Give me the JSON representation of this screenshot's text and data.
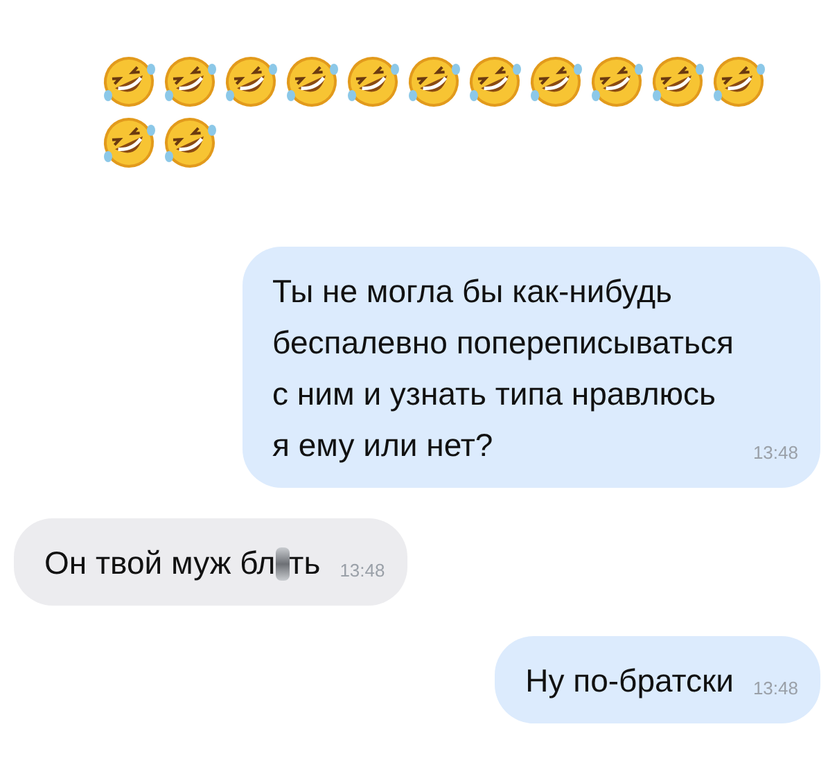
{
  "emojis": [
    {
      "kind": "rofl"
    },
    {
      "kind": "rofl"
    },
    {
      "kind": "rofl"
    },
    {
      "kind": "rofl"
    },
    {
      "kind": "rofl"
    },
    {
      "kind": "rofl"
    },
    {
      "kind": "rofl"
    },
    {
      "kind": "rofl"
    },
    {
      "kind": "rofl"
    },
    {
      "kind": "rofl"
    },
    {
      "kind": "rofl"
    },
    {
      "kind": "rofl"
    },
    {
      "kind": "rofl"
    }
  ],
  "messages": [
    {
      "kind": "out",
      "parts": [
        {
          "kind": "text",
          "text": "Ты не могла бы как-нибудь\nбеспалевно попереписываться\nс ним и узнать типа нравлюсь\nя ему или нет?"
        }
      ],
      "time": "13:48"
    },
    {
      "kind": "in",
      "parts": [
        {
          "kind": "text",
          "text": "Он твой муж бл"
        },
        {
          "kind": "censor"
        },
        {
          "kind": "text",
          "text": "ть"
        }
      ],
      "time": "13:48"
    },
    {
      "kind": "out",
      "parts": [
        {
          "kind": "text",
          "text": "Ну по-братски"
        }
      ],
      "time": "13:48"
    }
  ]
}
